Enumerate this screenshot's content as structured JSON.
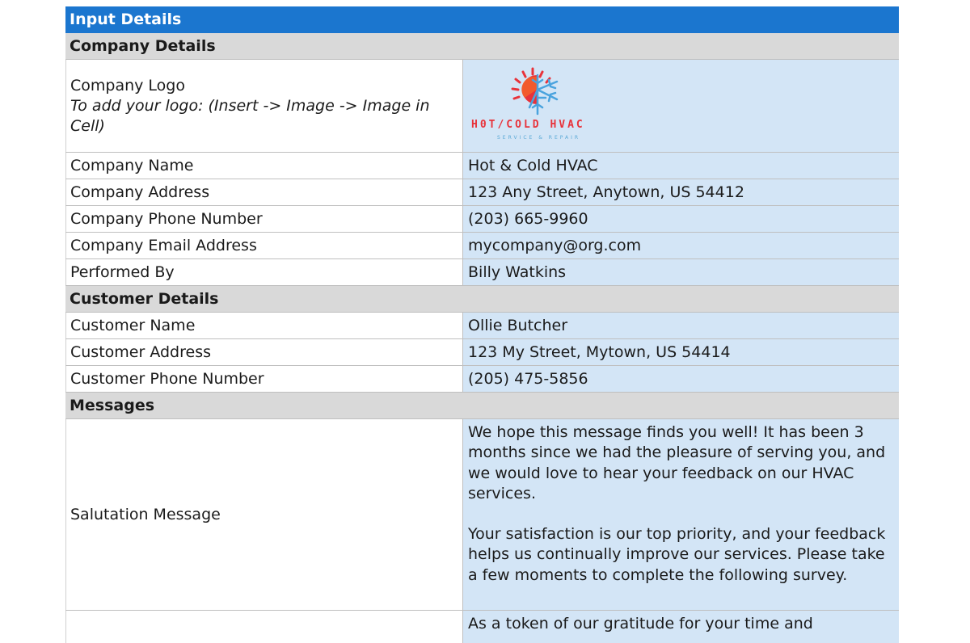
{
  "header": {
    "title": "Input Details"
  },
  "company": {
    "section_title": "Company Details",
    "logo_label": "Company Logo",
    "logo_hint": "To add your logo: (Insert -> Image -> Image in Cell)",
    "logo_text": "H0T/COLD HVAC",
    "logo_subtext": "SERVICE & REPAIR",
    "rows": [
      {
        "label": "Company Name",
        "value": "Hot & Cold HVAC"
      },
      {
        "label": "Company Address",
        "value": "123 Any Street, Anytown, US 54412"
      },
      {
        "label": "Company Phone Number",
        "value": "(203) 665-9960"
      },
      {
        "label": "Company Email Address",
        "value": "mycompany@org.com"
      },
      {
        "label": "Performed By",
        "value": "Billy Watkins"
      }
    ]
  },
  "customer": {
    "section_title": "Customer Details",
    "rows": [
      {
        "label": "Customer Name",
        "value": "Ollie Butcher"
      },
      {
        "label": "Customer Address",
        "value": "123 My Street, Mytown, US 54414"
      },
      {
        "label": "Customer Phone Number",
        "value": "(205) 475-5856"
      }
    ]
  },
  "messages": {
    "section_title": "Messages",
    "salutation_label": "Salutation Message",
    "salutation_p1": "We hope this message finds you well! It has been 3 months since we had the pleasure of serving you, and we would love to hear your feedback on our HVAC services.",
    "salutation_p2": "Your satisfaction is our top priority, and your feedback helps us continually improve our services. Please take a few moments to complete the following survey.",
    "closing_label": "",
    "closing_partial": "As a token of our gratitude for your time and"
  },
  "colors": {
    "header_blue": "#1b76cf",
    "section_gray": "#d9d9d9",
    "input_cell_blue": "#d3e5f6",
    "logo_red": "#e8323a",
    "logo_blue": "#5aa9d6"
  }
}
